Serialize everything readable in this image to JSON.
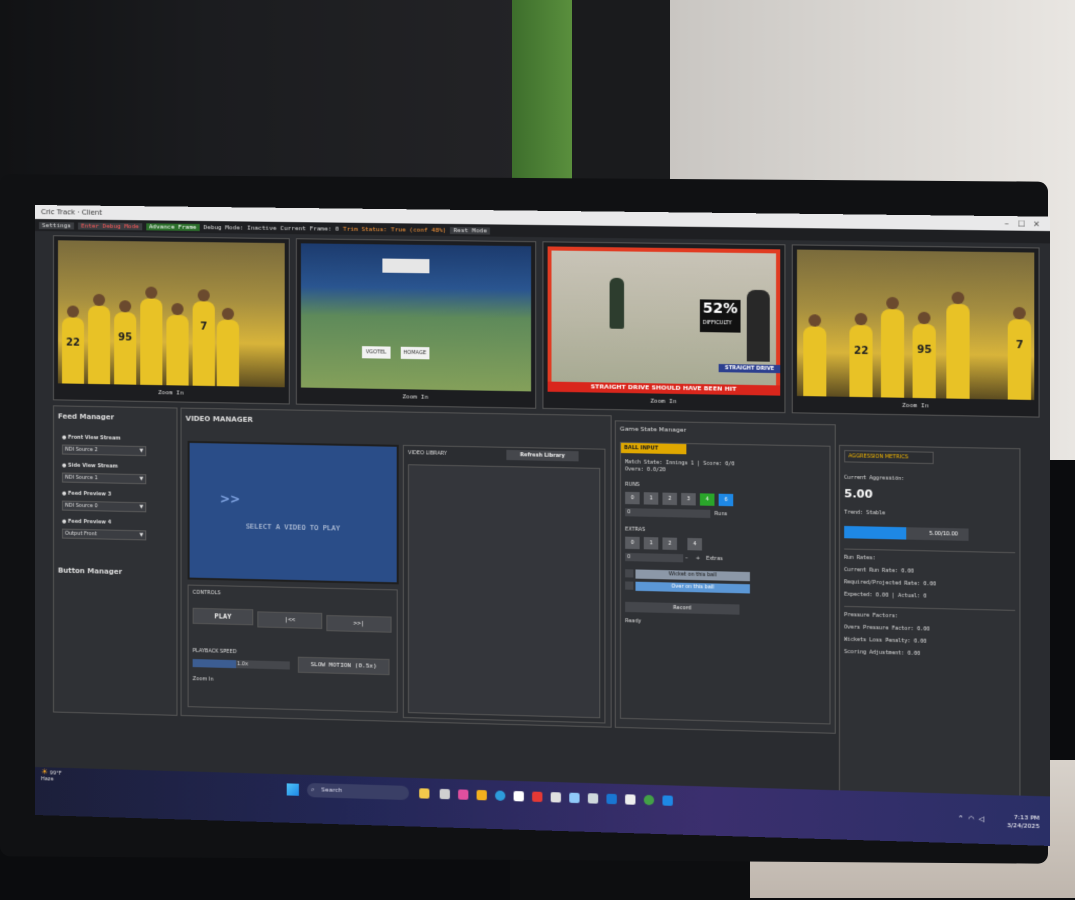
{
  "window": {
    "title": "Cric Track · Client",
    "controls": [
      "–",
      "☐",
      "✕"
    ]
  },
  "toolbar": {
    "settings": "Settings",
    "debug": "Enter Debug Mode",
    "advance": "Advance Frame",
    "status": "Debug Mode: Inactive Current Frame: 0",
    "trim": "Trim Status: True (conf 48%)",
    "reset": "Rest Mode"
  },
  "feeds": {
    "zoom_label": "Zoom In",
    "sponsor1": "VGOTEL",
    "sponsor2": "HOMAGE",
    "difficulty_pct": "52%",
    "difficulty_lbl": "DIFFICULTY",
    "sd_tag": "STRAIGHT DRIVE",
    "banner": "STRAIGHT DRIVE SHOULD HAVE BEEN HIT",
    "numbers_a": [
      "22",
      "7",
      "95"
    ],
    "numbers_b": [
      "22",
      "95",
      "7"
    ]
  },
  "feed_manager": {
    "title": "Feed Manager",
    "items": [
      {
        "label": "Front View Stream",
        "value": "NDI Source 2"
      },
      {
        "label": "Side View Stream",
        "value": "NDI Source 1"
      },
      {
        "label": "Feed Preview 3",
        "value": "NDI Source 0"
      },
      {
        "label": "Feed Preview 4",
        "value": "Output Front"
      }
    ],
    "button_manager": "Button Manager"
  },
  "video_manager": {
    "title": "VIDEO MANAGER",
    "player_icon": ">>",
    "player_msg": "SELECT A VIDEO TO PLAY",
    "controls_title": "CONTROLS",
    "play": "PLAY",
    "prev": "|<<",
    "next": ">>|",
    "speed_label": "PLAYBACK SPEED",
    "speed_value": "1.0x",
    "speed_fraction": 0.45,
    "slow_motion": "SLOW MOTION (0.5x)",
    "zoom": "Zoom In",
    "library_title": "VIDEO LIBRARY",
    "refresh": "Refresh Library"
  },
  "game_state": {
    "title": "Game State Manager",
    "ball_input": "BALL INPUT",
    "match_state": "Match State: Innings 1 | Score: 0/0",
    "overs": "Overs: 0.0/20",
    "runs_label": "RUNS",
    "runs": [
      "0",
      "1",
      "2",
      "3",
      "4",
      "6"
    ],
    "runs_field": "0",
    "runs_unit": "Runs",
    "extras_label": "EXTRAS",
    "extras": [
      "0",
      "1",
      "2",
      "4"
    ],
    "extras_field": "0",
    "extras_minus": "–",
    "extras_plus": "+",
    "extras_unit": "Extras",
    "wicket": "Wicket on this ball",
    "over": "Over on this ball",
    "record": "Record",
    "ready": "Ready"
  },
  "aggression": {
    "title": "AGGRESSION METRICS",
    "current_label": "Current Aggression:",
    "current_value": "5.00",
    "trend": "Trend:  Stable",
    "bar_value": "5.00/10.00",
    "bar_fraction": 0.5,
    "run_rates": "Run Rates:",
    "crr": "Current Run Rate: 0.00",
    "rrr": "Required/Projected Rate: 0.00",
    "expected": "Expected: 0.00 | Actual: 0",
    "pressure": "Pressure Factors:",
    "overs_pf": "Overs Pressure Factor: 0.00",
    "wickets_pf": "Wickets Loss Penalty: 0.00",
    "scoring_adj": "Scoring Adjustment: 0.00"
  },
  "taskbar": {
    "weather_temp": "99°F",
    "weather_desc": "Haze",
    "search": "Search",
    "time": "7:13 PM",
    "date": "3/24/2025"
  },
  "colors": {
    "accent_yellow": "#e0a800",
    "accent_blue": "#1e88e5",
    "accent_green": "#2aa52a"
  }
}
